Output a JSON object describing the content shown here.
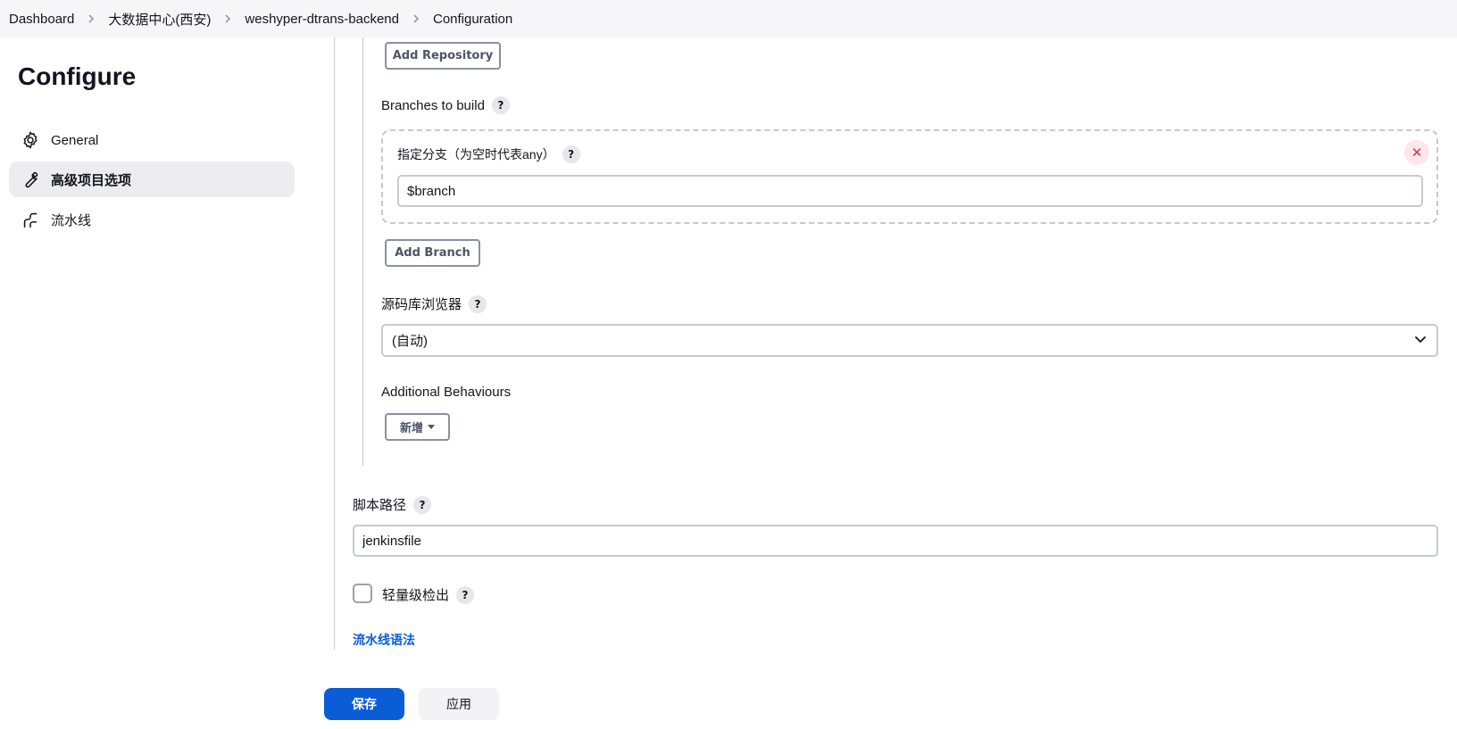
{
  "breadcrumb": {
    "items": [
      "Dashboard",
      "大数据中心(西安)",
      "weshyper-dtrans-backend",
      "Configuration"
    ]
  },
  "sidebar": {
    "title": "Configure",
    "items": [
      {
        "label": "General",
        "icon": "gear-icon",
        "active": false
      },
      {
        "label": "高级项目选项",
        "icon": "wrench-icon",
        "active": true
      },
      {
        "label": "流水线",
        "icon": "pipeline-icon",
        "active": false
      }
    ]
  },
  "scm": {
    "add_repository_label": "Add Repository",
    "branches_label": "Branches to build",
    "branch_specifier_label": "指定分支（为空时代表any）",
    "branch_specifier_value": "$branch",
    "add_branch_label": "Add Branch",
    "repo_browser_label": "源码库浏览器",
    "repo_browser_value": "(自动)",
    "additional_behaviours_label": "Additional Behaviours",
    "add_new_label": "新增"
  },
  "script_path": {
    "label": "脚本路径",
    "value": "jenkinsfile"
  },
  "lightweight_checkout": {
    "label": "轻量级检出",
    "checked": false
  },
  "pipeline_syntax_link": "流水线语法",
  "help_symbol": "?",
  "close_symbol": "✕",
  "actions": {
    "save_label": "保存",
    "apply_label": "应用"
  },
  "colors": {
    "primary": "#0b5dd7",
    "danger": "#e02947",
    "border": "#c6c9d1",
    "sidebar_active_bg": "#ececf1"
  }
}
